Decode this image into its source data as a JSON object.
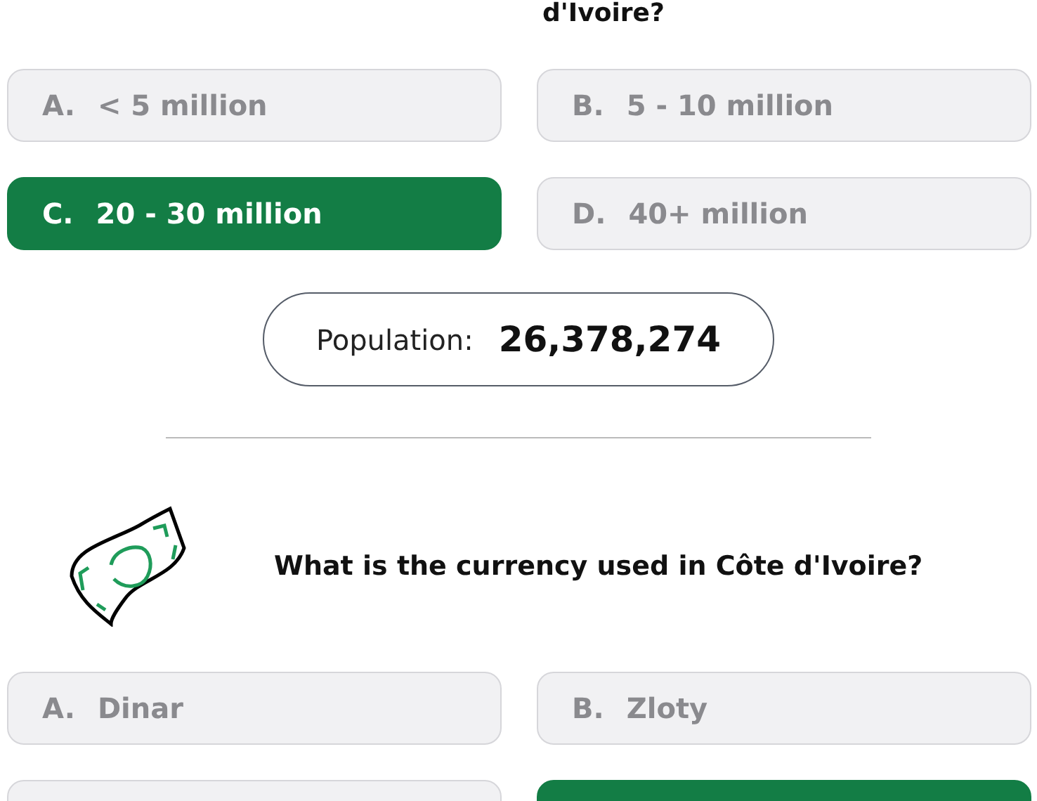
{
  "previous_question": {
    "text_end": "d'Ivoire?"
  },
  "population_question": {
    "options": [
      {
        "letter": "A.",
        "label": "< 5 million",
        "selected": false
      },
      {
        "letter": "B.",
        "label": "5 - 10 million",
        "selected": false
      },
      {
        "letter": "C.",
        "label": "20 - 30 million",
        "selected": true
      },
      {
        "letter": "D.",
        "label": "40+ million",
        "selected": false
      }
    ],
    "result": {
      "label": "Population:",
      "value": "26,378,274"
    }
  },
  "currency_question": {
    "question": "What is the currency used in Côte d'Ivoire?",
    "options": [
      {
        "letter": "A.",
        "label": "Dinar",
        "selected": false
      },
      {
        "letter": "B.",
        "label": "Zloty",
        "selected": false
      }
    ],
    "more_options": [
      {
        "selected": false
      },
      {
        "selected": true
      }
    ]
  }
}
